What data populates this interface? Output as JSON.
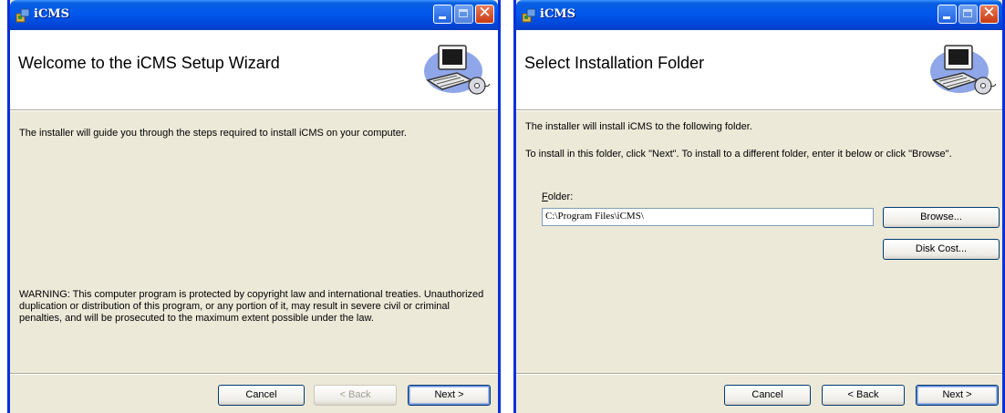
{
  "window1": {
    "title": "iCMS",
    "banner_title": "Welcome to the iCMS Setup Wizard",
    "intro": "The installer will guide you through the steps required to install iCMS on your computer.",
    "warning": "WARNING: This computer program is protected by copyright law and international treaties. Unauthorized duplication or distribution of this program, or any portion of it, may result in severe civil or criminal penalties, and will be prosecuted to the maximum extent possible under the law.",
    "buttons": {
      "cancel": "Cancel",
      "back": "< Back",
      "next": "Next >"
    }
  },
  "window2": {
    "title": "iCMS",
    "banner_title": "Select Installation Folder",
    "line1": "The installer will install iCMS to the following folder.",
    "line2": "To install in this folder, click \"Next\". To install to a different folder, enter it below or click \"Browse\".",
    "folder_label": "Folder:",
    "folder_value": "C:\\Program Files\\iCMS\\",
    "browse_label": "Browse...",
    "disk_cost_label": "Disk Cost...",
    "buttons": {
      "cancel": "Cancel",
      "back": "< Back",
      "next": "Next >"
    }
  },
  "icons": {
    "app": "installer-package-icon",
    "banner": "computer-with-disc-icon"
  },
  "colors": {
    "titlebar": "#0058ee",
    "dialog_bg": "#ece9d8",
    "close_button": "#c93a12"
  }
}
